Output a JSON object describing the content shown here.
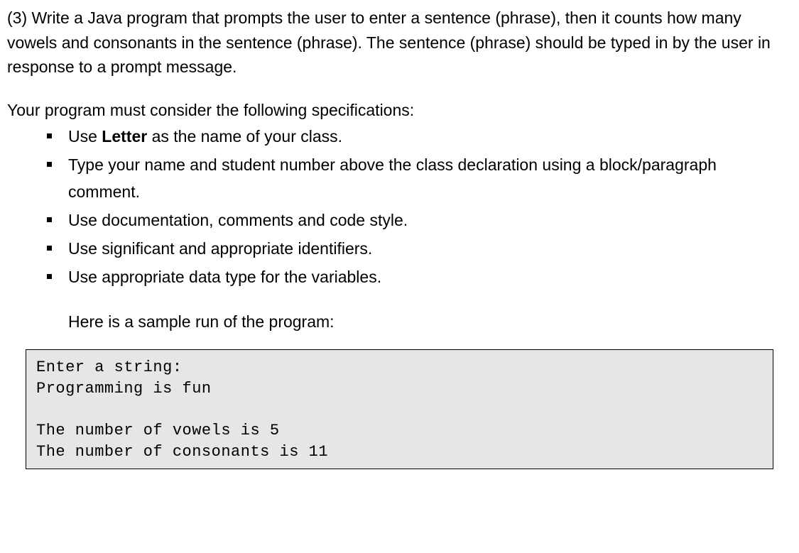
{
  "question": {
    "prompt": "(3) Write a Java program that prompts the user to enter a sentence (phrase), then it counts how many vowels and consonants in the sentence (phrase). The sentence (phrase) should be typed in by the user in response to a prompt message."
  },
  "specs_intro": "Your program must consider the following specifications:",
  "specs": [
    {
      "pre": "Use ",
      "bold": "Letter",
      "post": " as the name of your class."
    },
    {
      "text": "Type your name and student number above the class declaration using a block/paragraph comment."
    },
    {
      "text": "Use documentation, comments and code style."
    },
    {
      "text": "Use significant and appropriate identifiers."
    },
    {
      "text": "Use appropriate data type for the variables."
    }
  ],
  "sample_label": "Here is a sample run of the program:",
  "sample_output": "Enter a string:\nProgramming is fun\n\nThe number of vowels is 5\nThe number of consonants is 11"
}
